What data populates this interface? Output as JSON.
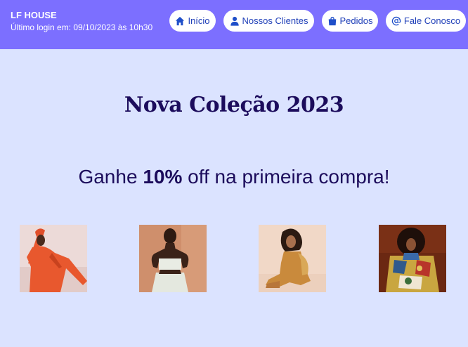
{
  "header": {
    "brand": "LF HOUSE",
    "last_login": "Último login em: 09/10/2023 às 10h30"
  },
  "nav": {
    "inicio": {
      "label": "Início",
      "icon": "home-icon"
    },
    "clientes": {
      "label": "Nossos Clientes",
      "icon": "user-icon"
    },
    "pedidos": {
      "label": "Pedidos",
      "icon": "shopping-bag-icon"
    },
    "fale": {
      "label": "Fale Conosco",
      "icon": "at-icon"
    }
  },
  "hero": {
    "title": "Nova Coleção 2023",
    "promo_prefix": "Ganhe ",
    "promo_highlight": "10%",
    "promo_suffix": " off na primeira compra!"
  },
  "colors": {
    "header_bg": "#7c6fff",
    "page_bg": "#dbe3ff",
    "heading_text": "#1c0c5c",
    "nav_text": "#1f3fb8"
  }
}
